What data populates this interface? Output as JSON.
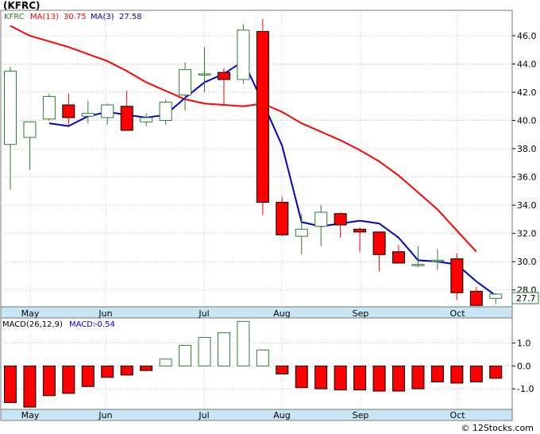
{
  "title": "(KFRC)",
  "footer": "© 12Stocks.com",
  "colors": {
    "up": "#2e7d32",
    "down": "#ff0000",
    "ma13": "#ff0000",
    "ma3": "#0000cc",
    "axisband": "#c6e6f5",
    "grid": "#c0c0c0",
    "last_price_box": "#2e7d32"
  },
  "chart_data": [
    {
      "type": "candlestick",
      "title": "",
      "legend": [
        {
          "label": "KFRC",
          "color": "#2e7d32"
        },
        {
          "label": "MA(13)",
          "value": "30.75",
          "color": "#ff0000"
        },
        {
          "label": "MA(3)",
          "value": "27.58",
          "color": "#0000cc"
        }
      ],
      "x_labels": [
        "May",
        "Jun",
        "Jul",
        "Aug",
        "Sep",
        "Oct"
      ],
      "y_ticks": [
        28.0,
        30.0,
        32.0,
        34.0,
        36.0,
        38.0,
        40.0,
        42.0,
        44.0,
        46.0
      ],
      "y_tick_labels": [
        "28.0",
        "30.0",
        "32.0",
        "34.0",
        "36.0",
        "38.0",
        "40.0",
        "42.0",
        "44.0",
        "46.0"
      ],
      "ylim": [
        26.8,
        47.8
      ],
      "last_price": "27.7",
      "grid": true,
      "candles": [
        {
          "o": 38.3,
          "h": 43.8,
          "l": 35.1,
          "c": 43.5
        },
        {
          "o": 38.8,
          "h": 39.7,
          "l": 36.5,
          "c": 39.9
        },
        {
          "o": 40.1,
          "h": 41.9,
          "l": 40.0,
          "c": 41.7
        },
        {
          "o": 41.1,
          "h": 41.9,
          "l": 39.6,
          "c": 40.2
        },
        {
          "o": 40.3,
          "h": 41.4,
          "l": 39.8,
          "c": 40.5
        },
        {
          "o": 40.2,
          "h": 41.2,
          "l": 39.7,
          "c": 41.1
        },
        {
          "o": 41.0,
          "h": 42.1,
          "l": 39.3,
          "c": 39.3
        },
        {
          "o": 39.9,
          "h": 40.5,
          "l": 39.6,
          "c": 40.2
        },
        {
          "o": 40.0,
          "h": 41.5,
          "l": 39.7,
          "c": 41.3
        },
        {
          "o": 41.8,
          "h": 44.1,
          "l": 40.7,
          "c": 43.6
        },
        {
          "o": 43.3,
          "h": 45.2,
          "l": 42.0,
          "c": 43.3
        },
        {
          "o": 43.4,
          "h": 43.7,
          "l": 41.1,
          "c": 42.9
        },
        {
          "o": 42.9,
          "h": 46.8,
          "l": 42.6,
          "c": 46.4
        },
        {
          "o": 46.3,
          "h": 47.2,
          "l": 33.3,
          "c": 34.2
        },
        {
          "o": 34.2,
          "h": 34.6,
          "l": 31.8,
          "c": 31.9
        },
        {
          "o": 31.8,
          "h": 33.4,
          "l": 30.5,
          "c": 32.3
        },
        {
          "o": 32.5,
          "h": 34.0,
          "l": 31.1,
          "c": 33.5
        },
        {
          "o": 33.4,
          "h": 33.5,
          "l": 31.7,
          "c": 32.6
        },
        {
          "o": 32.3,
          "h": 32.4,
          "l": 30.7,
          "c": 32.1
        },
        {
          "o": 32.1,
          "h": 32.1,
          "l": 29.3,
          "c": 30.5
        },
        {
          "o": 30.7,
          "h": 31.2,
          "l": 29.9,
          "c": 29.9
        },
        {
          "o": 29.8,
          "h": 31.1,
          "l": 29.6,
          "c": 29.8
        },
        {
          "o": 30.1,
          "h": 30.9,
          "l": 29.4,
          "c": 30.1
        },
        {
          "o": 30.2,
          "h": 30.6,
          "l": 27.3,
          "c": 27.8
        },
        {
          "o": 27.9,
          "h": 28.2,
          "l": 26.9,
          "c": 26.9
        },
        {
          "o": 27.4,
          "h": 27.8,
          "l": 27.0,
          "c": 27.7
        }
      ],
      "ma13": [
        46.7,
        46.0,
        45.6,
        45.2,
        44.7,
        44.2,
        43.5,
        42.7,
        42.1,
        41.5,
        41.2,
        41.1,
        41.0,
        41.2,
        40.6,
        39.8,
        39.2,
        38.6,
        37.9,
        37.1,
        36.1,
        34.9,
        33.7,
        32.2,
        30.7
      ],
      "ma3": [
        39.8,
        39.6,
        40.3,
        40.6,
        40.4,
        40.2,
        40.4,
        41.6,
        42.7,
        43.3,
        44.2,
        41.3,
        38.2,
        32.8,
        32.5,
        32.7,
        32.9,
        32.7,
        31.7,
        30.1,
        30.0,
        29.8,
        28.6,
        27.6
      ]
    },
    {
      "type": "bar",
      "title": "",
      "legend": [
        {
          "label": "MACD(26,12,9)",
          "color": "#000000"
        },
        {
          "label": "MACD:",
          "value": "-0.54",
          "color": "#0000cc"
        }
      ],
      "x_labels": [
        "May",
        "Jun",
        "Jul",
        "Aug",
        "Sep",
        "Oct"
      ],
      "y_ticks": [
        1.0,
        0.0,
        -1.0
      ],
      "y_tick_labels": [
        "1.0",
        "0.0",
        "-1.0"
      ],
      "ylim": [
        -1.9,
        2.1
      ],
      "values": [
        -1.6,
        -1.8,
        -1.3,
        -1.2,
        -0.9,
        -0.5,
        -0.4,
        -0.2,
        0.3,
        0.9,
        1.25,
        1.45,
        1.95,
        0.7,
        -0.35,
        -0.95,
        -1.0,
        -1.05,
        -1.05,
        -1.1,
        -1.1,
        -1.0,
        -0.7,
        -0.75,
        -0.7,
        -0.54
      ]
    }
  ]
}
